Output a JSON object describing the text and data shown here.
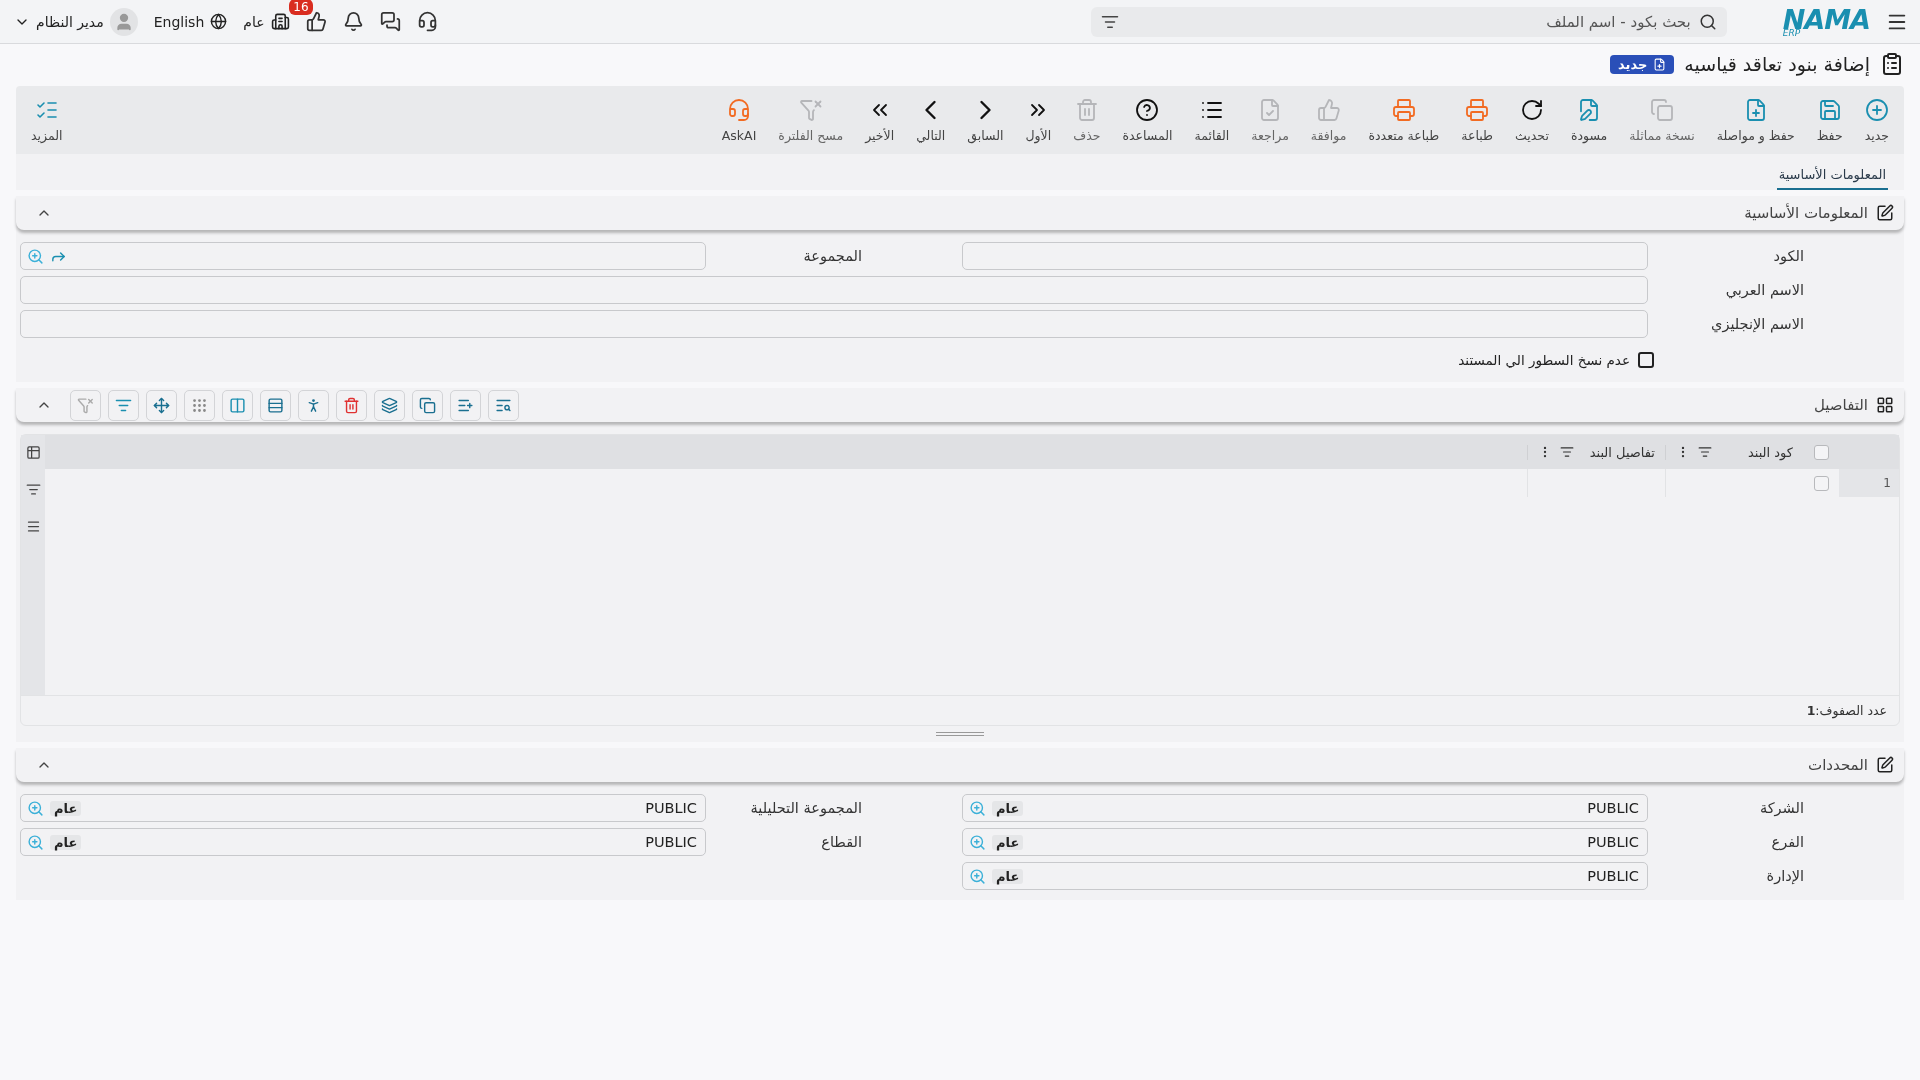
{
  "header": {
    "logo": "NAMA",
    "logo_sub": "ERP",
    "search": {
      "placeholder": "بحث بكود - اسم الملف"
    },
    "likes_badge": "16",
    "company": "عام",
    "language": "English",
    "user": "مدير النظام"
  },
  "page": {
    "title": "إضافة بنود تعاقد قياسيه",
    "status": "جديد"
  },
  "toolbar": [
    {
      "label": "جديد",
      "disabled": false
    },
    {
      "label": "حفظ",
      "disabled": false
    },
    {
      "label": "حفظ و مواصلة",
      "disabled": false
    },
    {
      "label": "نسخة مماثلة",
      "disabled": true
    },
    {
      "label": "مسودة",
      "disabled": false
    },
    {
      "label": "تحديث",
      "disabled": false
    },
    {
      "label": "طباعة",
      "disabled": false
    },
    {
      "label": "طباعة متعددة",
      "disabled": false
    },
    {
      "label": "موافقة",
      "disabled": true
    },
    {
      "label": "مراجعة",
      "disabled": true
    },
    {
      "label": "القائمة",
      "disabled": false
    },
    {
      "label": "المساعدة",
      "disabled": false
    },
    {
      "label": "حذف",
      "disabled": true
    },
    {
      "label": "الأول",
      "disabled": false
    },
    {
      "label": "السابق",
      "disabled": false
    },
    {
      "label": "التالي",
      "disabled": false
    },
    {
      "label": "الأخير",
      "disabled": false
    },
    {
      "label": "مسح الفلترة",
      "disabled": true
    },
    {
      "label": "AskAI",
      "disabled": false
    }
  ],
  "more": {
    "label": "المزيد"
  },
  "tabs": [
    {
      "label": "المعلومات الأساسية",
      "selected": true
    }
  ],
  "basic_info": {
    "title": "المعلومات الأساسية",
    "expanded": true,
    "fields": [
      {
        "label": "الكود",
        "kind": "half"
      },
      {
        "label": "المجموعة",
        "kind": "lookup"
      },
      {
        "label": "الاسم العربي",
        "kind": "full"
      },
      {
        "label": "الاسم الإنجليزي",
        "kind": "full"
      }
    ],
    "checkbox": {
      "label": "عدم نسخ السطور الي المستند",
      "checked": false
    }
  },
  "details": {
    "title": "التفاصيل",
    "expanded": true,
    "select_all": false,
    "columns": [
      "كود البند",
      "تفاصيل البند"
    ],
    "rows": [
      {
        "number": "1",
        "selected": false
      }
    ],
    "row_count": "عدد الصفوف:**1**"
  },
  "determinants": {
    "title": "المحددات",
    "expanded": true,
    "fields": [
      {
        "label": "الشركة",
        "value": "PUBLIC",
        "tag": "عام"
      },
      {
        "label": "المجموعة التحليلية",
        "value": "PUBLIC",
        "tag": "عام"
      },
      {
        "label": "الفرع",
        "value": "PUBLIC",
        "tag": "عام"
      },
      {
        "label": "القطاع",
        "value": "PUBLIC",
        "tag": "عام"
      },
      {
        "label": "الإدارة",
        "value": "PUBLIC",
        "tag": "عام"
      }
    ]
  }
}
